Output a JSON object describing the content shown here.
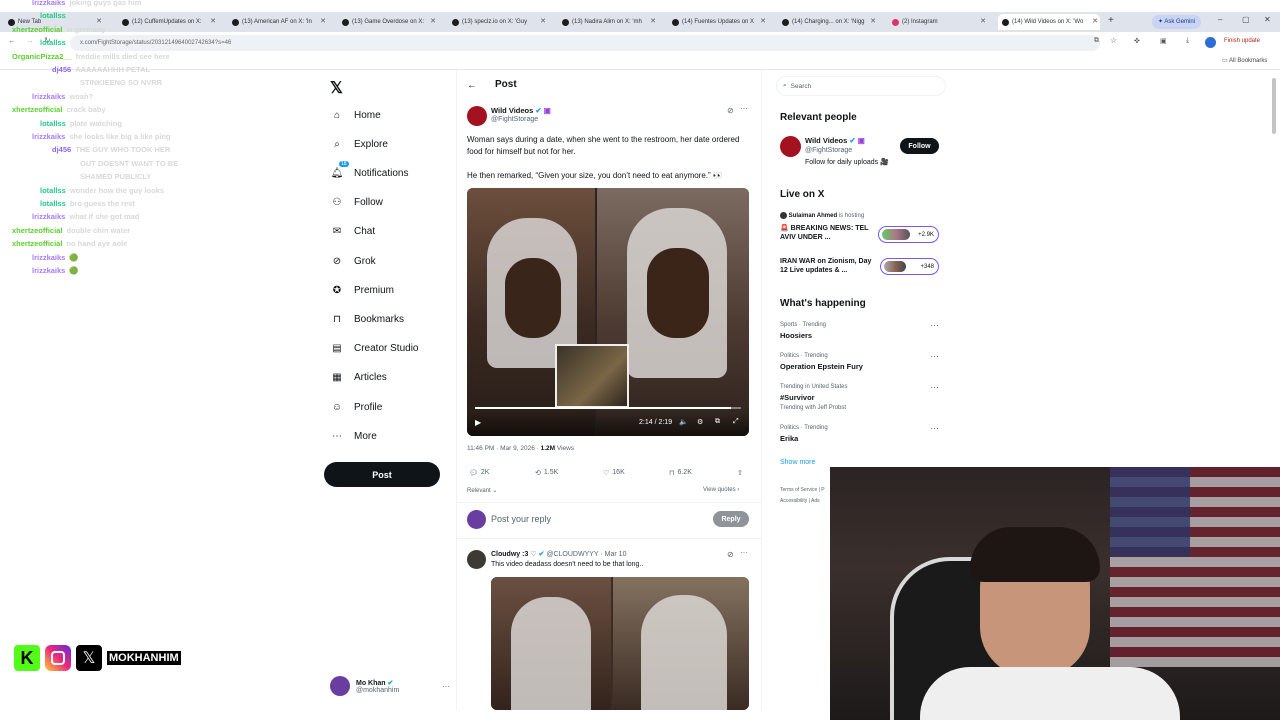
{
  "browser": {
    "tabs": [
      {
        "label": "New Tab"
      },
      {
        "label": "(12) CuffemUpdates on X:"
      },
      {
        "label": "(13) American AF on X: 'In"
      },
      {
        "label": "(13) Game Overdose on X:"
      },
      {
        "label": "(13) speclz.io on X: 'Guy"
      },
      {
        "label": "(13) Nadira Alim on X: 'mh"
      },
      {
        "label": "(14) Fuentes Updates on X"
      },
      {
        "label": "(14) Charging... on X: 'Nigg"
      },
      {
        "label": "(2) Instagram"
      },
      {
        "label": "(14) Wild Videos on X: 'Wo"
      }
    ],
    "ask_gemini": "Ask Gemini",
    "url": "x.com/FightStorage/status/2031214964002742634?s=46",
    "finish_update": "Finish update",
    "all_bookmarks": "All Bookmarks"
  },
  "chat": [
    {
      "user": "lrizzkaiks",
      "color": "#a77bff",
      "msg": "joking guys gas him"
    },
    {
      "user": "lotallss",
      "color": "#22c98a",
      "msg": ""
    },
    {
      "user": "xhertzeofficial",
      "color": "#5ccf2d",
      "msg": "w germany"
    },
    {
      "user": "lotallss",
      "color": "#22c98a",
      "msg": ""
    },
    {
      "user": "OrganicPizza2__",
      "color": "#5ccf2d",
      "msg": "freddie mills died see here"
    },
    {
      "user": "dj456",
      "color": "#8a67ff",
      "msg": "AAAAAAHHH PETAL"
    },
    {
      "user": "",
      "color": "#8a67ff",
      "msg": "STINKIEENG SO NVRR"
    },
    {
      "user": "lrizzkaiks",
      "color": "#a77bff",
      "msg": "woah?"
    },
    {
      "user": "xhertzeofficial",
      "color": "#5ccf2d",
      "msg": "crack baby"
    },
    {
      "user": "lotallss",
      "color": "#22c98a",
      "msg": "plate watching"
    },
    {
      "user": "lrizzkaiks",
      "color": "#a77bff",
      "msg": "she looks like big a like ping"
    },
    {
      "user": "dj456",
      "color": "#8a67ff",
      "msg": "THE GUY WHO TOOK HER"
    },
    {
      "user": "",
      "color": "#8a67ff",
      "msg": "OUT DOESNT WANT TO BE"
    },
    {
      "user": "",
      "color": "#8a67ff",
      "msg": "SHAMED PUBLICLY"
    },
    {
      "user": "lotallss",
      "color": "#22c98a",
      "msg": "wonder how the guy looks"
    },
    {
      "user": "lotallss",
      "color": "#22c98a",
      "msg": "bro guess the rest"
    },
    {
      "user": "lrizzkaiks",
      "color": "#a77bff",
      "msg": "what if she got mad"
    },
    {
      "user": "xhertzeofficial",
      "color": "#5ccf2d",
      "msg": "double chin water"
    },
    {
      "user": "xhertzeofficial",
      "color": "#5ccf2d",
      "msg": "no hand aye aole"
    },
    {
      "user": "lrizzkaiks",
      "color": "#a77bff",
      "msg": "🟢"
    },
    {
      "user": "lrizzkaiks",
      "color": "#a77bff",
      "msg": "🟢"
    }
  ],
  "socials": {
    "handle": "MOKHANHIM"
  },
  "nav": {
    "items": [
      {
        "label": "Home",
        "icon": "home-icon"
      },
      {
        "label": "Explore",
        "icon": "search-icon"
      },
      {
        "label": "Notifications",
        "icon": "bell-icon",
        "badge": "18"
      },
      {
        "label": "Follow",
        "icon": "follow-icon"
      },
      {
        "label": "Chat",
        "icon": "mail-icon"
      },
      {
        "label": "Grok",
        "icon": "grok-icon"
      },
      {
        "label": "Premium",
        "icon": "premium-icon"
      },
      {
        "label": "Bookmarks",
        "icon": "bookmark-icon"
      },
      {
        "label": "Creator Studio",
        "icon": "studio-icon"
      },
      {
        "label": "Articles",
        "icon": "article-icon"
      },
      {
        "label": "Profile",
        "icon": "profile-icon"
      },
      {
        "label": "More",
        "icon": "more-icon"
      }
    ],
    "post_label": "Post",
    "account": {
      "name": "Mo Khan",
      "handle": "@mokhanhim"
    }
  },
  "post": {
    "header": "Post",
    "author": "Wild Videos",
    "handle": "@FightStorage",
    "text1": "Woman says during a date, when she went to the restroom, her date ordered food for himself but not for her.",
    "text2": "He then remarked, “Given your size, you don’t need to eat anymore.” 👀",
    "video_time": "2:14 / 2:19",
    "meta_time": "11:46 PM · Mar 9, 2026 · ",
    "views": "1.2M",
    "views_label": " Views",
    "stats": {
      "replies": "2K",
      "reposts": "1.5K",
      "likes": "16K",
      "bookmarks": "6.2K"
    },
    "relevant": "Relevant ⌄",
    "view_quotes": "View quotes ›",
    "reply_placeholder": "Post your reply",
    "reply_button": "Reply"
  },
  "reply": {
    "author": "Cloudwy :3",
    "handle": "@CLOUDWYYY · Mar 10",
    "text": "This video deadass doesn't need to be that long.."
  },
  "right": {
    "search_placeholder": "Search",
    "relevant_people": "Relevant people",
    "person": {
      "name": "Wild Videos",
      "handle": "@FightStorage",
      "bio": "Follow for daily uploads 🎥",
      "follow": "Follow"
    },
    "live_title": "Live on X",
    "live_host": "Sulaiman Ahmed",
    "live_host_suffix": " is hosting",
    "live": [
      {
        "title": "🚨 BREAKING NEWS: TEL AVIV UNDER ...",
        "count": "+2.9K"
      },
      {
        "title": "IRAN WAR on Zionism, Day 12 Live updates & ...",
        "count": "+348"
      }
    ],
    "happening_title": "What's happening",
    "trends": [
      {
        "meta": "Sports · Trending",
        "name": "Hoosiers"
      },
      {
        "meta": "Politics · Trending",
        "name": "Operation Epstein Fury"
      },
      {
        "meta": "Trending in United States",
        "name": "#Survivor",
        "sub": "Trending with Jeff Probst"
      },
      {
        "meta": "Politics · Trending",
        "name": "Erika"
      }
    ],
    "show_more": "Show more",
    "footer1": "Terms of Service | P",
    "footer2": "Accessibility | Ads"
  }
}
